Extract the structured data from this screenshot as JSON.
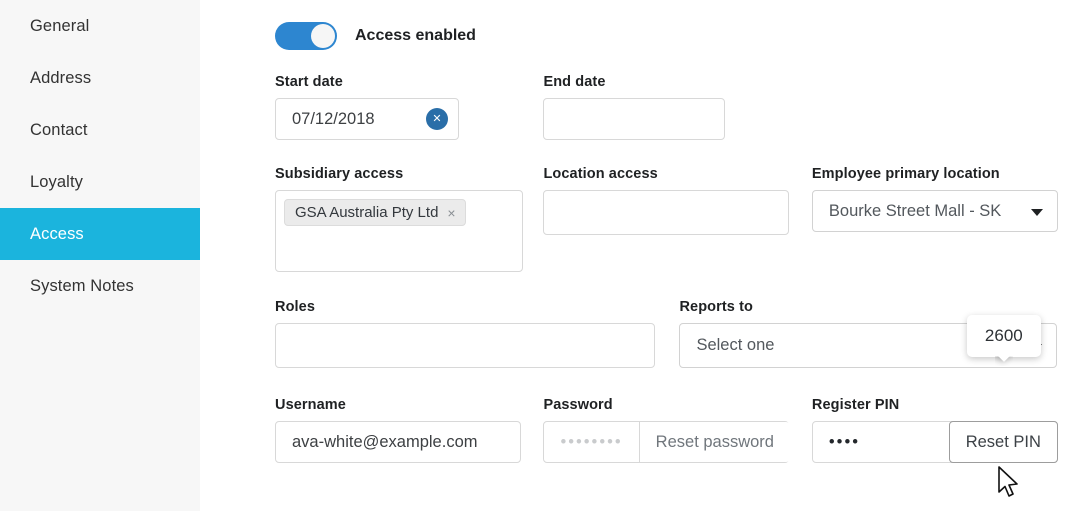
{
  "sidebar": {
    "items": [
      {
        "label": "General",
        "active": false
      },
      {
        "label": "Address",
        "active": false
      },
      {
        "label": "Contact",
        "active": false
      },
      {
        "label": "Loyalty",
        "active": false
      },
      {
        "label": "Access",
        "active": true
      },
      {
        "label": "System Notes",
        "active": false
      }
    ],
    "active_bg": "#1bb4dd",
    "bg": "#f7f7f7"
  },
  "access_toggle": {
    "label": "Access enabled",
    "enabled": true,
    "on_color": "#2d86d0"
  },
  "form": {
    "start_date": {
      "label": "Start date",
      "value": "07/12/2018",
      "clear_icon": "close-icon",
      "clear_glyph": "✕",
      "clear_color": "#2a6ea8"
    },
    "end_date": {
      "label": "End date",
      "value": "",
      "placeholder": ""
    },
    "subsidiary_access": {
      "label": "Subsidiary access",
      "chips": [
        {
          "label": "GSA Australia Pty Ltd",
          "remove_glyph": "×"
        }
      ]
    },
    "location_access": {
      "label": "Location access",
      "value": ""
    },
    "employee_primary_location": {
      "label": "Employee primary location",
      "value": "Bourke Street Mall - SK",
      "caret_icon": "chevron-down-icon"
    },
    "roles": {
      "label": "Roles",
      "value": ""
    },
    "reports_to": {
      "label": "Reports to",
      "value": "Select one",
      "caret_icon": "chevron-down-icon"
    },
    "username": {
      "label": "Username",
      "value": "ava-white@example.com"
    },
    "password": {
      "label": "Password",
      "masked_value": "••••••••",
      "reset_label": "Reset password"
    },
    "register_pin": {
      "label": "Register PIN",
      "masked_value": "••••",
      "reset_label": "Reset PIN",
      "tooltip": "2600"
    }
  }
}
